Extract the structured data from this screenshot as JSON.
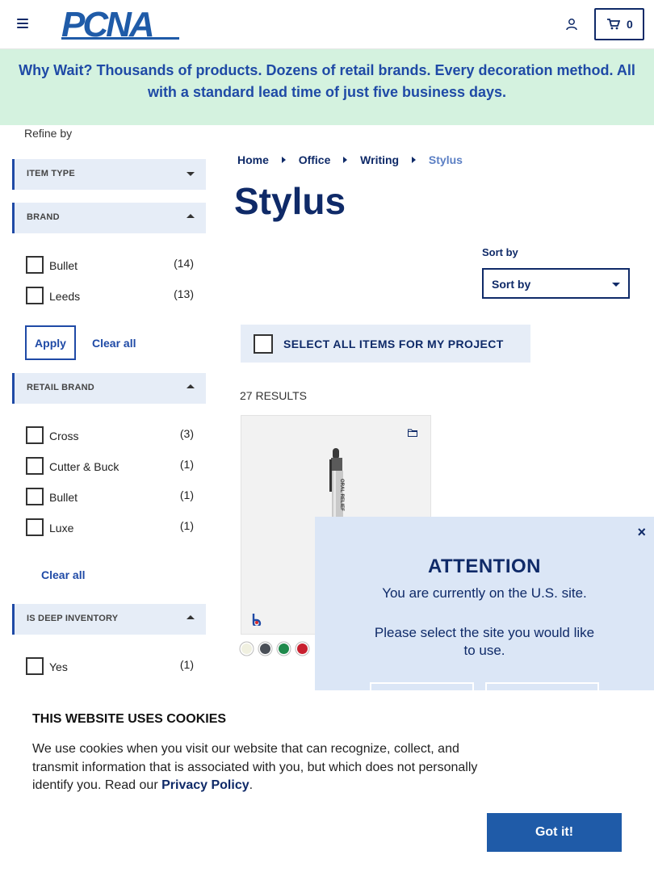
{
  "header": {
    "logo_text": "PCNA",
    "cart_count": "0"
  },
  "banner": {
    "text": "Why Wait? Thousands of products. Dozens of retail brands. Every decoration method. All with a standard lead time of just five business days."
  },
  "sidebar": {
    "refine_label": "Refine by",
    "facets": {
      "item_type": {
        "label": "ITEM TYPE",
        "expanded": false
      },
      "brand": {
        "label": "BRAND",
        "expanded": true,
        "options": [
          {
            "label": "Bullet",
            "count": "(14)"
          },
          {
            "label": "Leeds",
            "count": "(13)"
          }
        ],
        "apply_label": "Apply",
        "clear_label": "Clear all"
      },
      "retail_brand": {
        "label": "RETAIL BRAND",
        "expanded": true,
        "options": [
          {
            "label": "Cross",
            "count": "(3)"
          },
          {
            "label": "Cutter & Buck",
            "count": "(1)"
          },
          {
            "label": "Bullet",
            "count": "(1)"
          },
          {
            "label": "Luxe",
            "count": "(1)"
          }
        ],
        "clear_label": "Clear all"
      },
      "deep_inventory": {
        "label": "IS DEEP INVENTORY",
        "expanded": true,
        "options": [
          {
            "label": "Yes",
            "count": "(1)"
          }
        ]
      }
    }
  },
  "breadcrumb": {
    "items": [
      "Home",
      "Office",
      "Writing"
    ],
    "current": "Stylus"
  },
  "page_title": "Stylus",
  "sort": {
    "label": "Sort by",
    "value": "Sort by"
  },
  "select_all_label": "SELECT ALL ITEMS FOR MY PROJECT",
  "results_count": "27 RESULTS",
  "product": {
    "imprint_text": "ORAL RELIEF",
    "swatch_colors": [
      "#f0f0e0",
      "#4a4f57",
      "#1f8a4c",
      "#c8202f"
    ]
  },
  "attention": {
    "close_label": "×",
    "title": "ATTENTION",
    "line1": "You are currently on the U.S. site.",
    "line2": "Please select the site you would like to use."
  },
  "cookie": {
    "title": "THIS WEBSITE USES COOKIES",
    "text_before": "We use cookies when you visit our website that can recognize, collect, and transmit information that is associated with you, but which does not personally identify you. Read our ",
    "link_text": "Privacy Policy",
    "text_after": ".",
    "button_label": "Got it!"
  },
  "colors": {
    "navy": "#0f2a68",
    "accent_blue": "#1f4aa6",
    "banner_bg": "#d4f2df",
    "facet_bg": "#e6edf7",
    "modal_bg": "#dbe6f6",
    "button_blue": "#1f5ba8"
  }
}
